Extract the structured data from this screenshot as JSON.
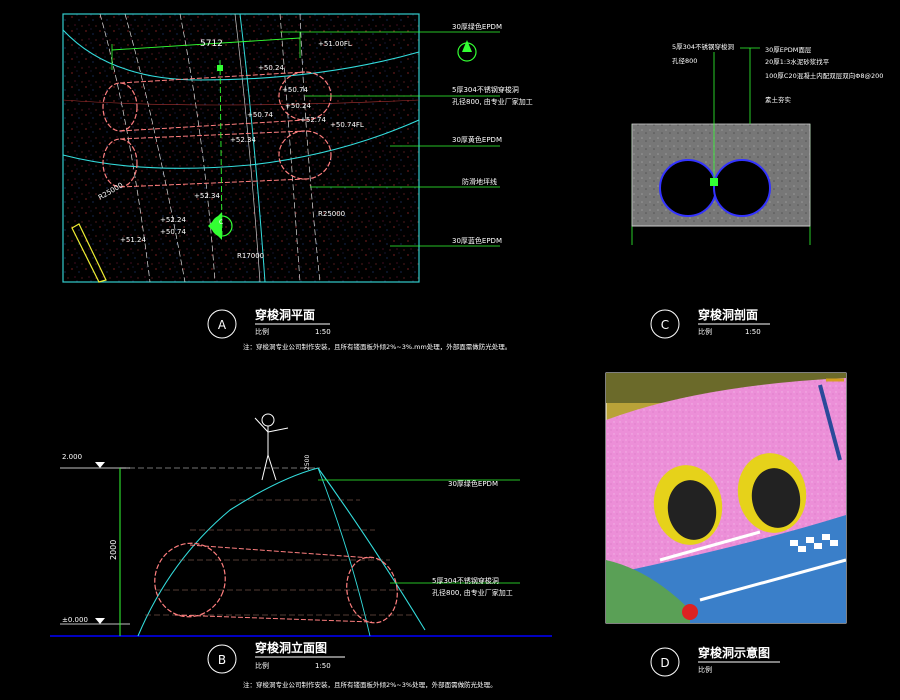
{
  "panel_a": {
    "letter": "A",
    "title": "穿梭洞平面",
    "scale_label": "比例",
    "scale_value": "1:50",
    "note": "注：穿梭洞专业公司制作安装，且所有镂面板外倾2%~3%.mm处理，外部面需做防光处理。",
    "dims": [
      "5712",
      "R25000",
      "R25000",
      "R17000"
    ],
    "elevations": [
      "+51.00FL",
      "+50.74",
      "+50.74",
      "+50.24",
      "+50.24",
      "+50.74FL",
      "+52.34",
      "+52.34",
      "+52.74",
      "+52.24",
      "+50.74",
      "+51.24",
      "+50.74FL"
    ],
    "callouts": [
      "30厚绿色EPDM",
      "5厚304不锈钢穿梭洞",
      "孔径800, 由专业厂家加工",
      "30厚黄色EPDM",
      "防滑地坪线",
      "30厚蓝色EPDM"
    ]
  },
  "panel_b": {
    "letter": "B",
    "title": "穿梭洞立面图",
    "scale_label": "比例",
    "scale_value": "1:50",
    "note": "注：穿梭洞专业公司制作安装，且所有镂面板外倾2%~3%处理，外部面需做防光处理。",
    "level_top": "2.000",
    "level_base": "±0.000",
    "height_dim": "2000",
    "callouts": [
      "30厚绿色EPDM",
      "5厚304不锈钢穿梭洞",
      "孔径800, 由专业厂家加工"
    ]
  },
  "panel_c": {
    "letter": "C",
    "title": "穿梭洞剖面",
    "scale_label": "比例",
    "scale_value": "1:50",
    "callouts": [
      "5厚304不锈钢穿梭洞",
      "孔径800",
      "30厚EPDM面层",
      "20厚1:3水泥砂浆找平",
      "100厚C20混凝土内配双层双向Φ8@200",
      "素土夯实"
    ]
  },
  "panel_d": {
    "letter": "D",
    "title": "穿梭洞示意图",
    "scale_label": "比例"
  },
  "colors": {
    "frame_cyan": "#33cccc",
    "callout_green": "#33ff33",
    "hole_red": "#ff7f7f",
    "curve_cyan": "#33dddd",
    "title_white": "#ffffff",
    "ground_blue": "#0000ff"
  }
}
